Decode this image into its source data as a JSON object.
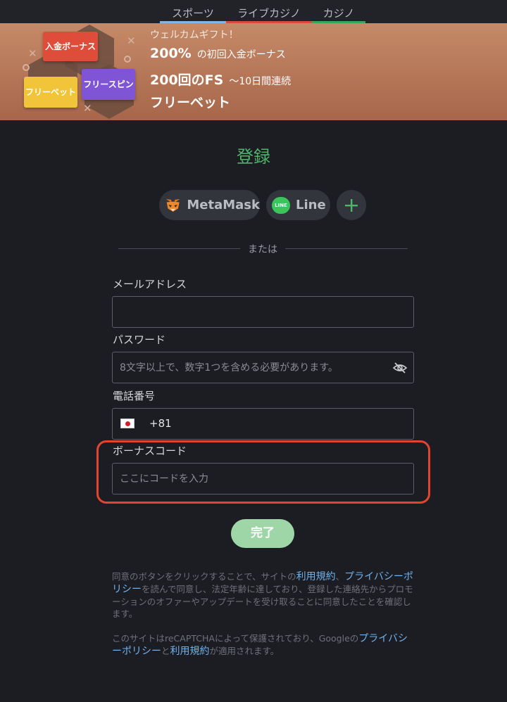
{
  "tabs": [
    {
      "label": "スポーツ",
      "color": "#7fb6e8"
    },
    {
      "label": "ライブカジノ",
      "color": "#d84a3c"
    },
    {
      "label": "カジノ",
      "color": "#3aa65a"
    }
  ],
  "banner": {
    "tags": {
      "deposit": "入金ボーナス",
      "freebet": "フリーベット",
      "freespin": "フリースピン"
    },
    "welcome": "ウェルカムギフト！",
    "line2_big": "200%",
    "line2_small": "の初回入金ボーナス",
    "line3_big": "200回のFS",
    "line3_small": "～10日間連続",
    "line4_big": "フリーベット"
  },
  "title": "登録",
  "sso": {
    "metamask": "MetaMask",
    "line": "Line",
    "line_logo_text": "LINE"
  },
  "or_text": "または",
  "form": {
    "email_label": "メールアドレス",
    "email_value": "",
    "password_label": "パスワード",
    "password_placeholder": "8文字以上で、数字1つを含める必要があります。",
    "phone_label": "電話番号",
    "phone_code": "+81",
    "bonus_label": "ボーナスコード",
    "bonus_placeholder": "ここにコードを入力",
    "submit_label": "完了"
  },
  "consent": {
    "p1": "同意のボタンをクリックすることで、サイトの",
    "terms_link": "利用規約",
    "sep": "、",
    "privacy_link": "プライバシーポリシー",
    "p2": "を読んで同意し、法定年齢に達しており、登録した連絡先からプロモーションのオファーやアップデートを受け取ることに同意したことを確認します。"
  },
  "recaptcha": {
    "p1": "このサイトはreCAPTCHAによって保護されており、Googleの",
    "privacy_link": "プライバシーポリシー",
    "and": "と",
    "terms_link": "利用規約",
    "p2": "が適用されます。"
  },
  "icons": {
    "metamask": "fox-icon",
    "line": "line-icon",
    "add": "plus-icon",
    "eye": "eye-slash-icon",
    "flag": "japan-flag-icon"
  },
  "colors": {
    "accent_green": "#4fb56a",
    "submit_bg": "#9fd6a7",
    "link": "#6fb2ee",
    "highlight": "#e2452d"
  }
}
